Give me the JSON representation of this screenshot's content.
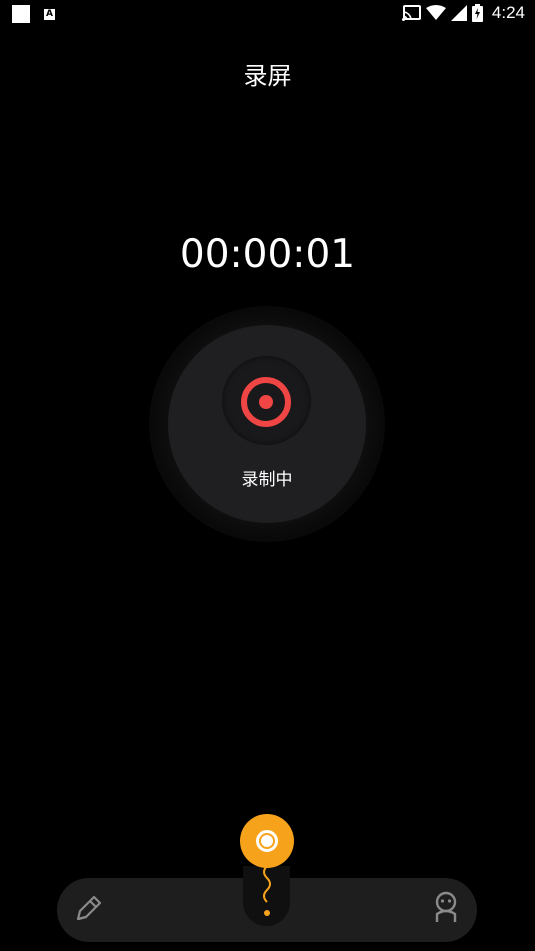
{
  "status_bar": {
    "time": "4:24",
    "icons": [
      "notification-square-icon",
      "font-a-icon",
      "cast-icon",
      "wifi-icon",
      "signal-icon",
      "battery-charging-icon"
    ]
  },
  "header": {
    "title": "录屏"
  },
  "recorder": {
    "timer": "00:00:01",
    "status_label": "录制中",
    "accent_color": "#f04545"
  },
  "toolbar": {
    "left_icon": "pen-icon",
    "right_icon": "robot-icon",
    "floating_button_color": "#f7a21b"
  }
}
